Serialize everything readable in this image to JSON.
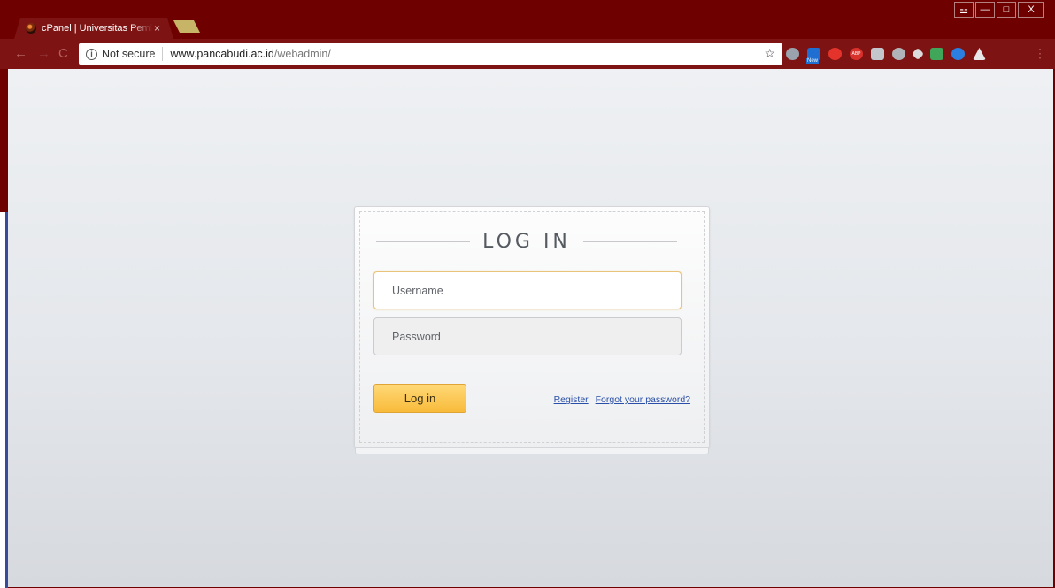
{
  "browser": {
    "tab": {
      "title": "cPanel | Universitas Pembangunan",
      "close": "×"
    },
    "window_controls": {
      "user": "⚍",
      "minimize": "—",
      "maximize": "□",
      "close": "X"
    },
    "nav": {
      "back": "←",
      "forward": "→",
      "reload": "C"
    },
    "address_bar": {
      "security_icon": "ⓘ",
      "security_label": "Not secure",
      "url_host": "www.pancabudi.ac.id",
      "url_path": "/webadmin/",
      "star": "☆"
    },
    "extension_icons": [
      "cloud-icon",
      "new-badge-icon",
      "opera-icon",
      "adblock-icon",
      "screen-icon",
      "gear-icon",
      "pen-icon",
      "green-save-icon",
      "download-icon",
      "acrobat-icon"
    ],
    "menu": "⋮"
  },
  "login": {
    "heading": "LOG IN",
    "username_placeholder": "Username",
    "password_placeholder": "Password",
    "submit_label": "Log in",
    "register_link": "Register",
    "forgot_link": "Forgot your password?"
  },
  "colors": {
    "chrome_frame": "#6e0000",
    "submit_button": "#f8bb3a",
    "focus_border": "#e8c47a",
    "link": "#2a4fa8"
  }
}
